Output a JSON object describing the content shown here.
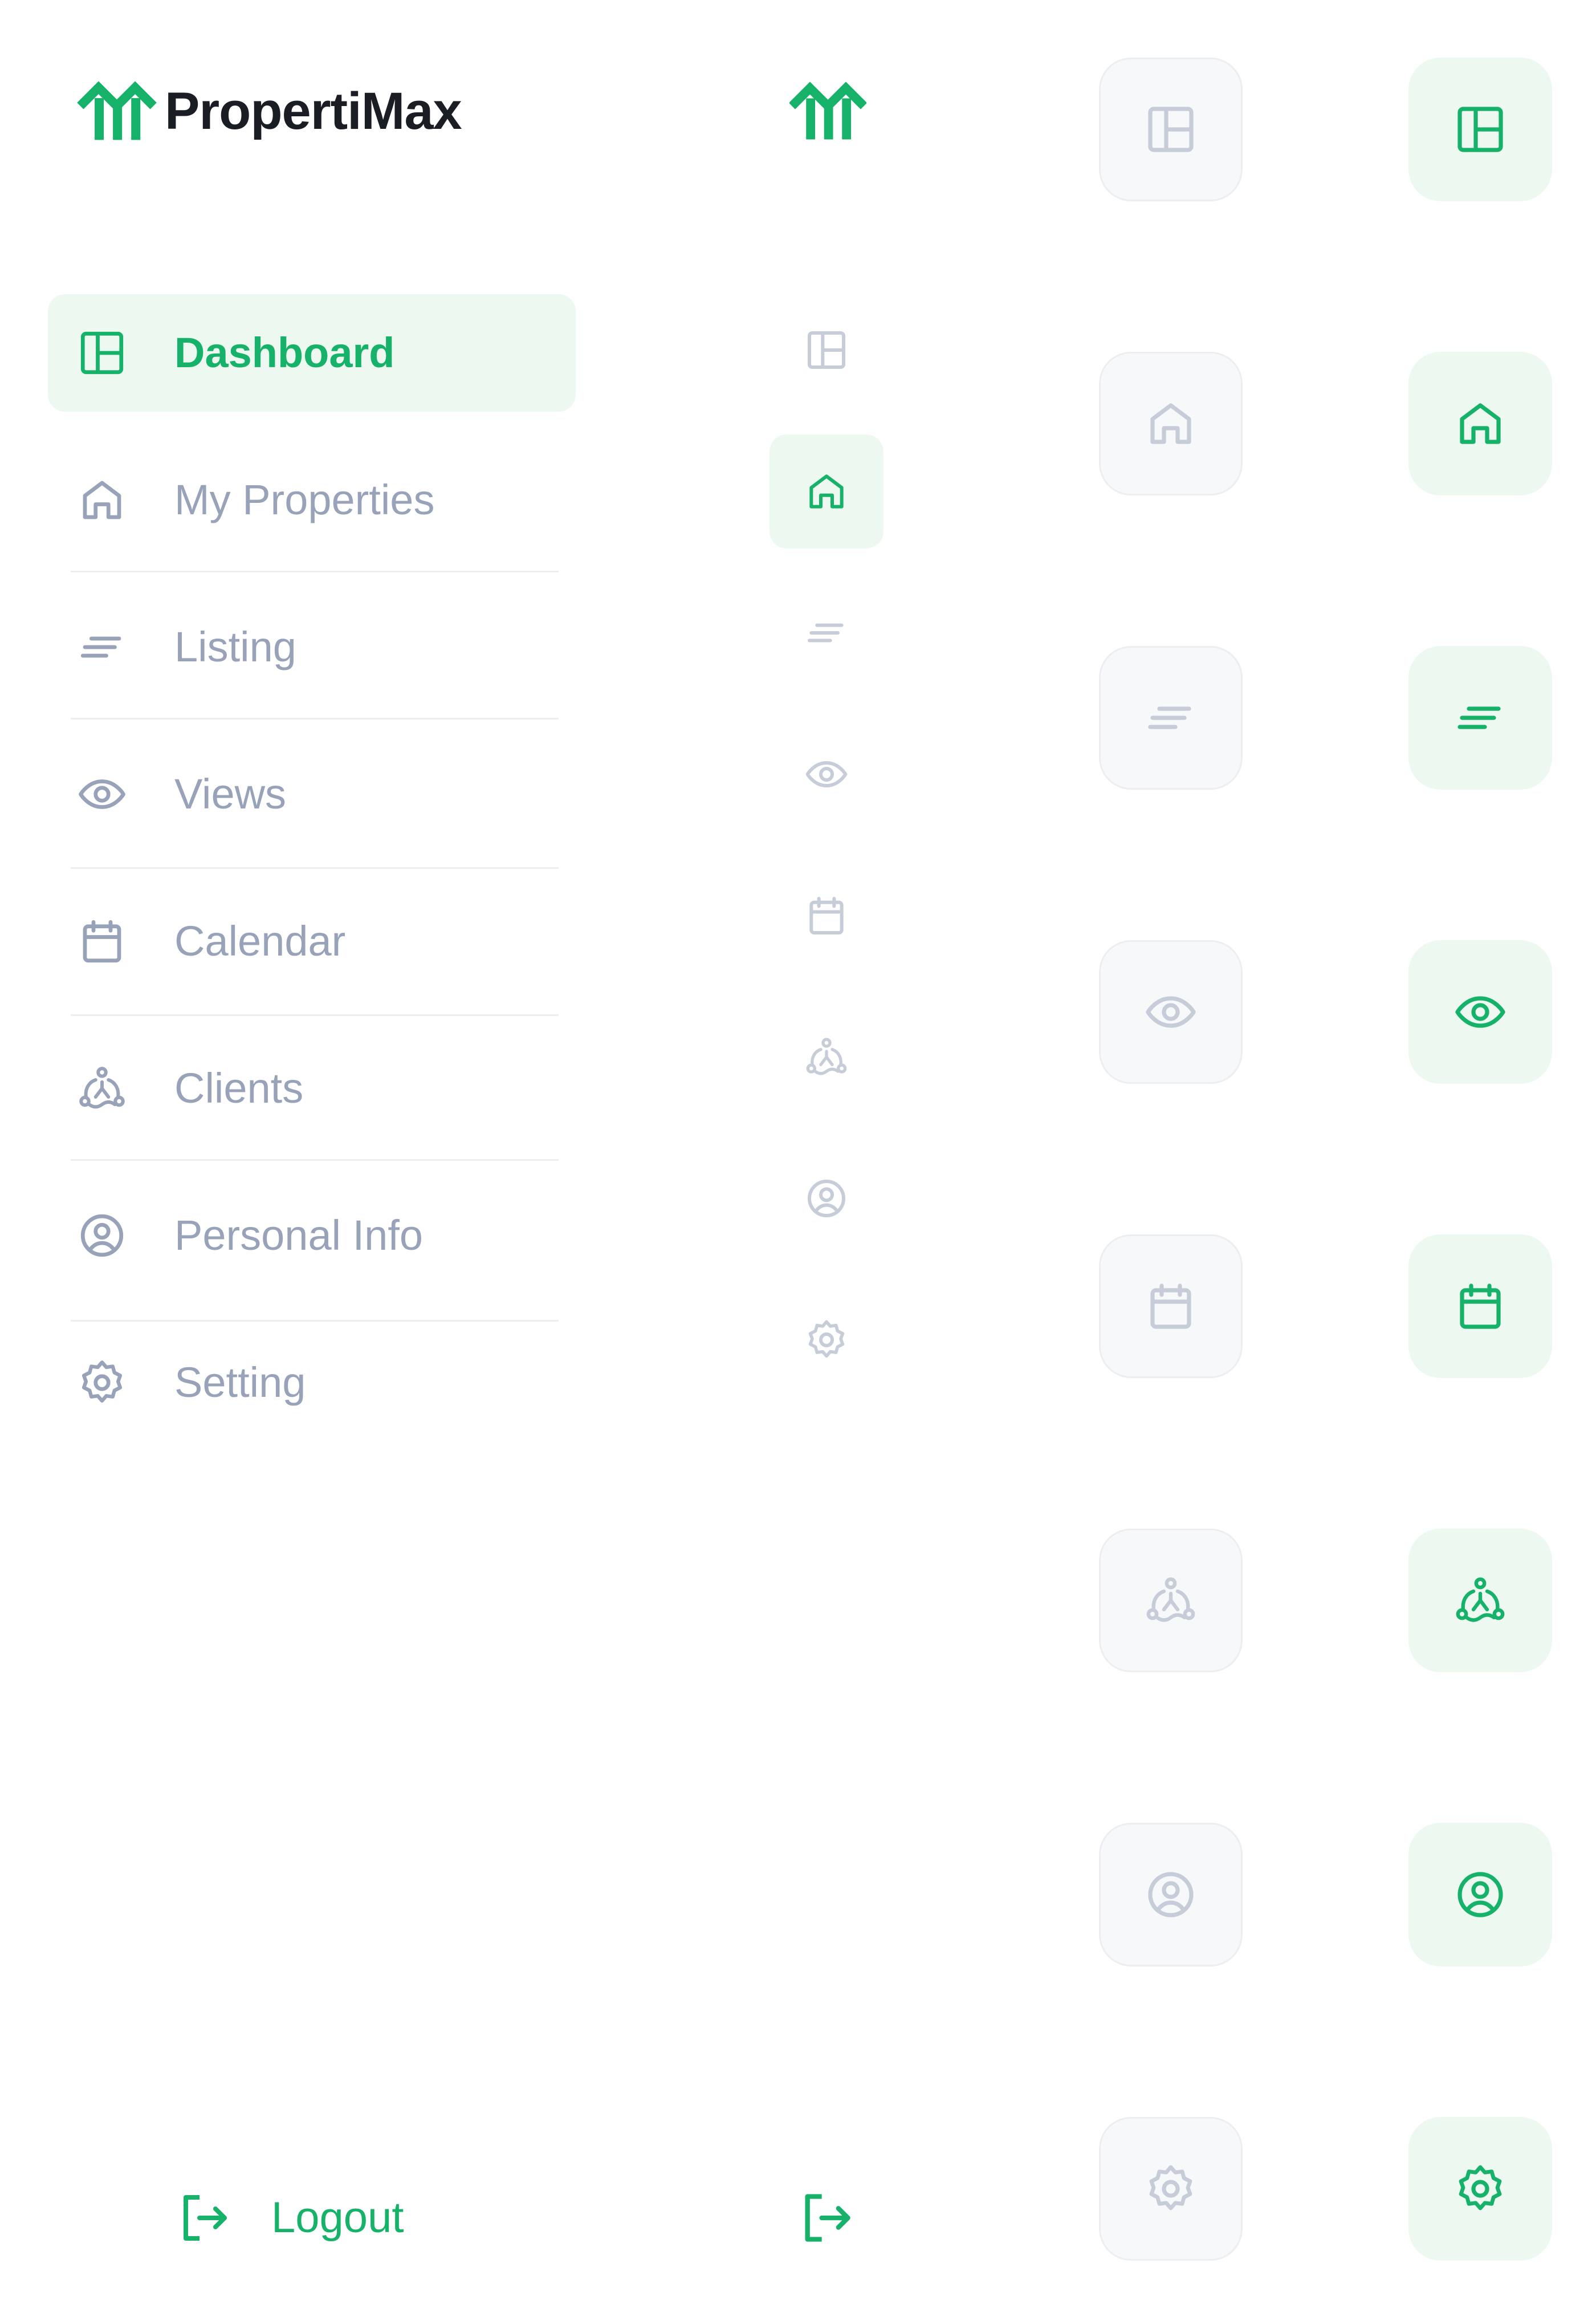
{
  "brand": {
    "name": "PropertiMax",
    "accent": "#17b26a",
    "text_color": "#1a1d23",
    "muted_color": "#98a2b8"
  },
  "sidebar": {
    "items": [
      {
        "label": "Dashboard",
        "icon": "dashboard-icon",
        "active": true
      },
      {
        "label": "My Properties",
        "icon": "home-icon",
        "active": false
      },
      {
        "label": "Listing",
        "icon": "listing-icon",
        "active": false
      },
      {
        "label": "Views",
        "icon": "eye-icon",
        "active": false
      },
      {
        "label": "Calendar",
        "icon": "calendar-icon",
        "active": false
      },
      {
        "label": "Clients",
        "icon": "clients-icon",
        "active": false
      },
      {
        "label": "Personal Info",
        "icon": "user-circle-icon",
        "active": false
      },
      {
        "label": "Setting",
        "icon": "gear-icon",
        "active": false
      }
    ],
    "logout_label": "Logout",
    "logout_icon": "logout-icon"
  },
  "collapsed_sidebar": {
    "active_item": "My Properties"
  },
  "icon_states": {
    "states": [
      "default",
      "active"
    ],
    "default_bg": "#f7f8fa",
    "active_bg": "#edf9f0"
  }
}
